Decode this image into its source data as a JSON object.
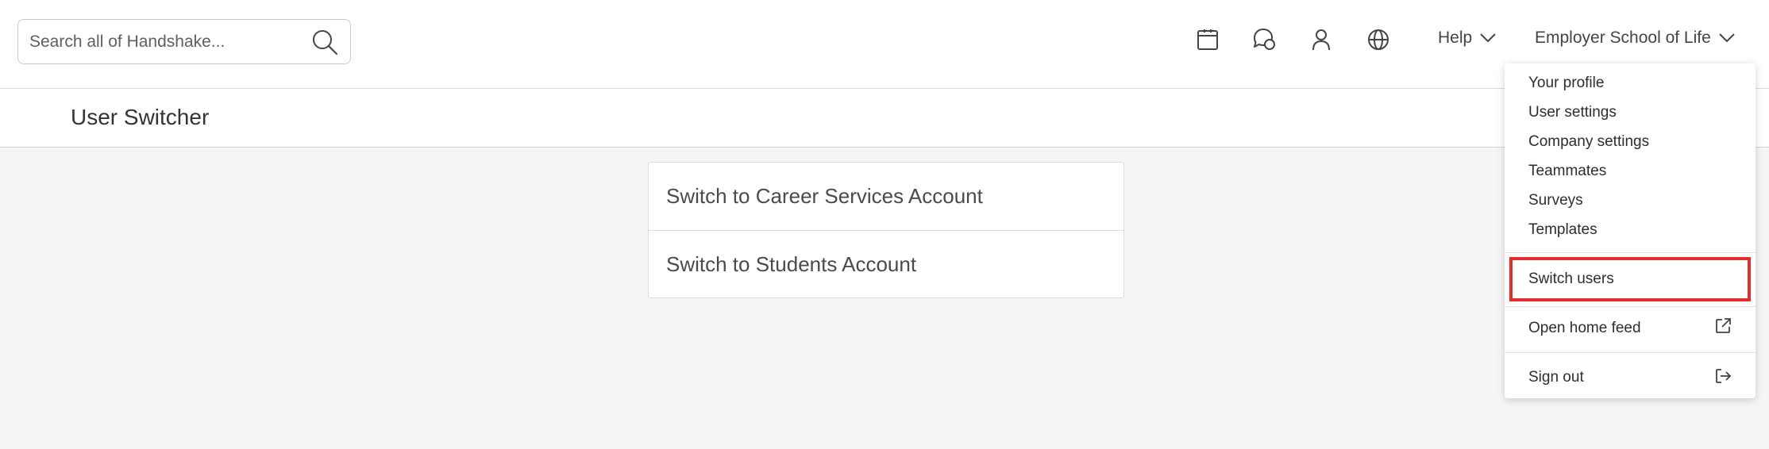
{
  "search": {
    "placeholder": "Search all of Handshake...",
    "icon": "search-icon"
  },
  "nav": {
    "icons": [
      "calendar-icon",
      "chat-icon",
      "person-icon",
      "globe-icon"
    ],
    "help_label": "Help",
    "account_label": "Employer School of Life"
  },
  "header": {
    "title": "User Switcher"
  },
  "switcher": {
    "items": [
      {
        "label": "Switch to Career Services Account"
      },
      {
        "label": "Switch to Students Account"
      }
    ]
  },
  "dropdown": {
    "items": [
      {
        "label": "Your profile"
      },
      {
        "label": "User settings"
      },
      {
        "label": "Company settings"
      },
      {
        "label": "Teammates"
      },
      {
        "label": "Surveys"
      },
      {
        "label": "Templates"
      }
    ],
    "switch_users": "Switch users",
    "open_home_feed": "Open home feed",
    "sign_out": "Sign out",
    "highlight_color": "#e0302a"
  }
}
